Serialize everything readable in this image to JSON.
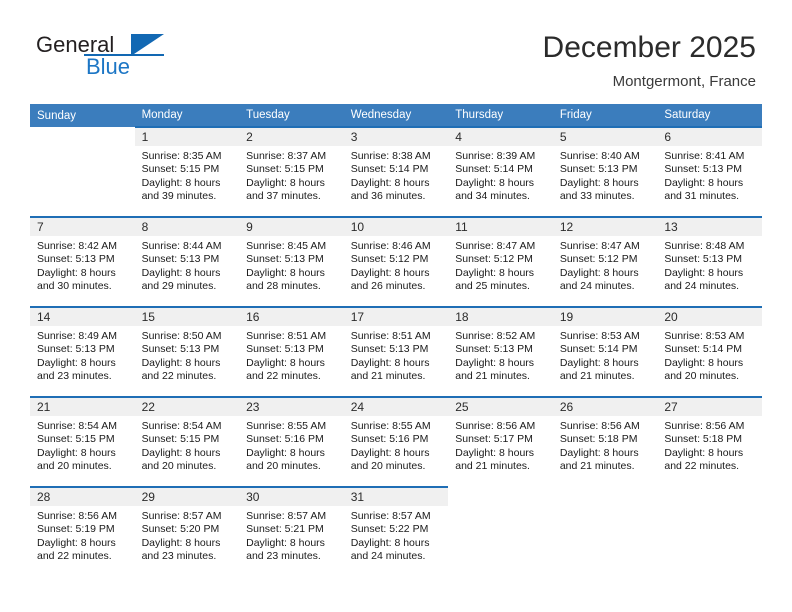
{
  "brand": {
    "name_part1": "General",
    "name_part2": "Blue",
    "flag_icon": "triangle-flag-icon",
    "accent_color": "#1268b3"
  },
  "header": {
    "month_title": "December 2025",
    "location": "Montgermont, France"
  },
  "calendar": {
    "header_color": "#3b7dbd",
    "row_border_color": "#1f6eb5",
    "daynum_bg": "#f0f0f0",
    "weekday_headers": [
      "Sunday",
      "Monday",
      "Tuesday",
      "Wednesday",
      "Thursday",
      "Friday",
      "Saturday"
    ],
    "weeks": [
      [
        {
          "day": "",
          "empty": true,
          "sunrise": "",
          "sunset": "",
          "daylight_line1": "",
          "daylight_line2": ""
        },
        {
          "day": "1",
          "sunrise": "Sunrise: 8:35 AM",
          "sunset": "Sunset: 5:15 PM",
          "daylight_line1": "Daylight: 8 hours",
          "daylight_line2": "and 39 minutes."
        },
        {
          "day": "2",
          "sunrise": "Sunrise: 8:37 AM",
          "sunset": "Sunset: 5:15 PM",
          "daylight_line1": "Daylight: 8 hours",
          "daylight_line2": "and 37 minutes."
        },
        {
          "day": "3",
          "sunrise": "Sunrise: 8:38 AM",
          "sunset": "Sunset: 5:14 PM",
          "daylight_line1": "Daylight: 8 hours",
          "daylight_line2": "and 36 minutes."
        },
        {
          "day": "4",
          "sunrise": "Sunrise: 8:39 AM",
          "sunset": "Sunset: 5:14 PM",
          "daylight_line1": "Daylight: 8 hours",
          "daylight_line2": "and 34 minutes."
        },
        {
          "day": "5",
          "sunrise": "Sunrise: 8:40 AM",
          "sunset": "Sunset: 5:13 PM",
          "daylight_line1": "Daylight: 8 hours",
          "daylight_line2": "and 33 minutes."
        },
        {
          "day": "6",
          "sunrise": "Sunrise: 8:41 AM",
          "sunset": "Sunset: 5:13 PM",
          "daylight_line1": "Daylight: 8 hours",
          "daylight_line2": "and 31 minutes."
        }
      ],
      [
        {
          "day": "7",
          "sunrise": "Sunrise: 8:42 AM",
          "sunset": "Sunset: 5:13 PM",
          "daylight_line1": "Daylight: 8 hours",
          "daylight_line2": "and 30 minutes."
        },
        {
          "day": "8",
          "sunrise": "Sunrise: 8:44 AM",
          "sunset": "Sunset: 5:13 PM",
          "daylight_line1": "Daylight: 8 hours",
          "daylight_line2": "and 29 minutes."
        },
        {
          "day": "9",
          "sunrise": "Sunrise: 8:45 AM",
          "sunset": "Sunset: 5:13 PM",
          "daylight_line1": "Daylight: 8 hours",
          "daylight_line2": "and 28 minutes."
        },
        {
          "day": "10",
          "sunrise": "Sunrise: 8:46 AM",
          "sunset": "Sunset: 5:12 PM",
          "daylight_line1": "Daylight: 8 hours",
          "daylight_line2": "and 26 minutes."
        },
        {
          "day": "11",
          "sunrise": "Sunrise: 8:47 AM",
          "sunset": "Sunset: 5:12 PM",
          "daylight_line1": "Daylight: 8 hours",
          "daylight_line2": "and 25 minutes."
        },
        {
          "day": "12",
          "sunrise": "Sunrise: 8:47 AM",
          "sunset": "Sunset: 5:12 PM",
          "daylight_line1": "Daylight: 8 hours",
          "daylight_line2": "and 24 minutes."
        },
        {
          "day": "13",
          "sunrise": "Sunrise: 8:48 AM",
          "sunset": "Sunset: 5:13 PM",
          "daylight_line1": "Daylight: 8 hours",
          "daylight_line2": "and 24 minutes."
        }
      ],
      [
        {
          "day": "14",
          "sunrise": "Sunrise: 8:49 AM",
          "sunset": "Sunset: 5:13 PM",
          "daylight_line1": "Daylight: 8 hours",
          "daylight_line2": "and 23 minutes."
        },
        {
          "day": "15",
          "sunrise": "Sunrise: 8:50 AM",
          "sunset": "Sunset: 5:13 PM",
          "daylight_line1": "Daylight: 8 hours",
          "daylight_line2": "and 22 minutes."
        },
        {
          "day": "16",
          "sunrise": "Sunrise: 8:51 AM",
          "sunset": "Sunset: 5:13 PM",
          "daylight_line1": "Daylight: 8 hours",
          "daylight_line2": "and 22 minutes."
        },
        {
          "day": "17",
          "sunrise": "Sunrise: 8:51 AM",
          "sunset": "Sunset: 5:13 PM",
          "daylight_line1": "Daylight: 8 hours",
          "daylight_line2": "and 21 minutes."
        },
        {
          "day": "18",
          "sunrise": "Sunrise: 8:52 AM",
          "sunset": "Sunset: 5:13 PM",
          "daylight_line1": "Daylight: 8 hours",
          "daylight_line2": "and 21 minutes."
        },
        {
          "day": "19",
          "sunrise": "Sunrise: 8:53 AM",
          "sunset": "Sunset: 5:14 PM",
          "daylight_line1": "Daylight: 8 hours",
          "daylight_line2": "and 21 minutes."
        },
        {
          "day": "20",
          "sunrise": "Sunrise: 8:53 AM",
          "sunset": "Sunset: 5:14 PM",
          "daylight_line1": "Daylight: 8 hours",
          "daylight_line2": "and 20 minutes."
        }
      ],
      [
        {
          "day": "21",
          "sunrise": "Sunrise: 8:54 AM",
          "sunset": "Sunset: 5:15 PM",
          "daylight_line1": "Daylight: 8 hours",
          "daylight_line2": "and 20 minutes."
        },
        {
          "day": "22",
          "sunrise": "Sunrise: 8:54 AM",
          "sunset": "Sunset: 5:15 PM",
          "daylight_line1": "Daylight: 8 hours",
          "daylight_line2": "and 20 minutes."
        },
        {
          "day": "23",
          "sunrise": "Sunrise: 8:55 AM",
          "sunset": "Sunset: 5:16 PM",
          "daylight_line1": "Daylight: 8 hours",
          "daylight_line2": "and 20 minutes."
        },
        {
          "day": "24",
          "sunrise": "Sunrise: 8:55 AM",
          "sunset": "Sunset: 5:16 PM",
          "daylight_line1": "Daylight: 8 hours",
          "daylight_line2": "and 20 minutes."
        },
        {
          "day": "25",
          "sunrise": "Sunrise: 8:56 AM",
          "sunset": "Sunset: 5:17 PM",
          "daylight_line1": "Daylight: 8 hours",
          "daylight_line2": "and 21 minutes."
        },
        {
          "day": "26",
          "sunrise": "Sunrise: 8:56 AM",
          "sunset": "Sunset: 5:18 PM",
          "daylight_line1": "Daylight: 8 hours",
          "daylight_line2": "and 21 minutes."
        },
        {
          "day": "27",
          "sunrise": "Sunrise: 8:56 AM",
          "sunset": "Sunset: 5:18 PM",
          "daylight_line1": "Daylight: 8 hours",
          "daylight_line2": "and 22 minutes."
        }
      ],
      [
        {
          "day": "28",
          "sunrise": "Sunrise: 8:56 AM",
          "sunset": "Sunset: 5:19 PM",
          "daylight_line1": "Daylight: 8 hours",
          "daylight_line2": "and 22 minutes."
        },
        {
          "day": "29",
          "sunrise": "Sunrise: 8:57 AM",
          "sunset": "Sunset: 5:20 PM",
          "daylight_line1": "Daylight: 8 hours",
          "daylight_line2": "and 23 minutes."
        },
        {
          "day": "30",
          "sunrise": "Sunrise: 8:57 AM",
          "sunset": "Sunset: 5:21 PM",
          "daylight_line1": "Daylight: 8 hours",
          "daylight_line2": "and 23 minutes."
        },
        {
          "day": "31",
          "sunrise": "Sunrise: 8:57 AM",
          "sunset": "Sunset: 5:22 PM",
          "daylight_line1": "Daylight: 8 hours",
          "daylight_line2": "and 24 minutes."
        },
        {
          "day": "",
          "empty": true,
          "sunrise": "",
          "sunset": "",
          "daylight_line1": "",
          "daylight_line2": ""
        },
        {
          "day": "",
          "empty": true,
          "sunrise": "",
          "sunset": "",
          "daylight_line1": "",
          "daylight_line2": ""
        },
        {
          "day": "",
          "empty": true,
          "sunrise": "",
          "sunset": "",
          "daylight_line1": "",
          "daylight_line2": ""
        }
      ]
    ]
  }
}
